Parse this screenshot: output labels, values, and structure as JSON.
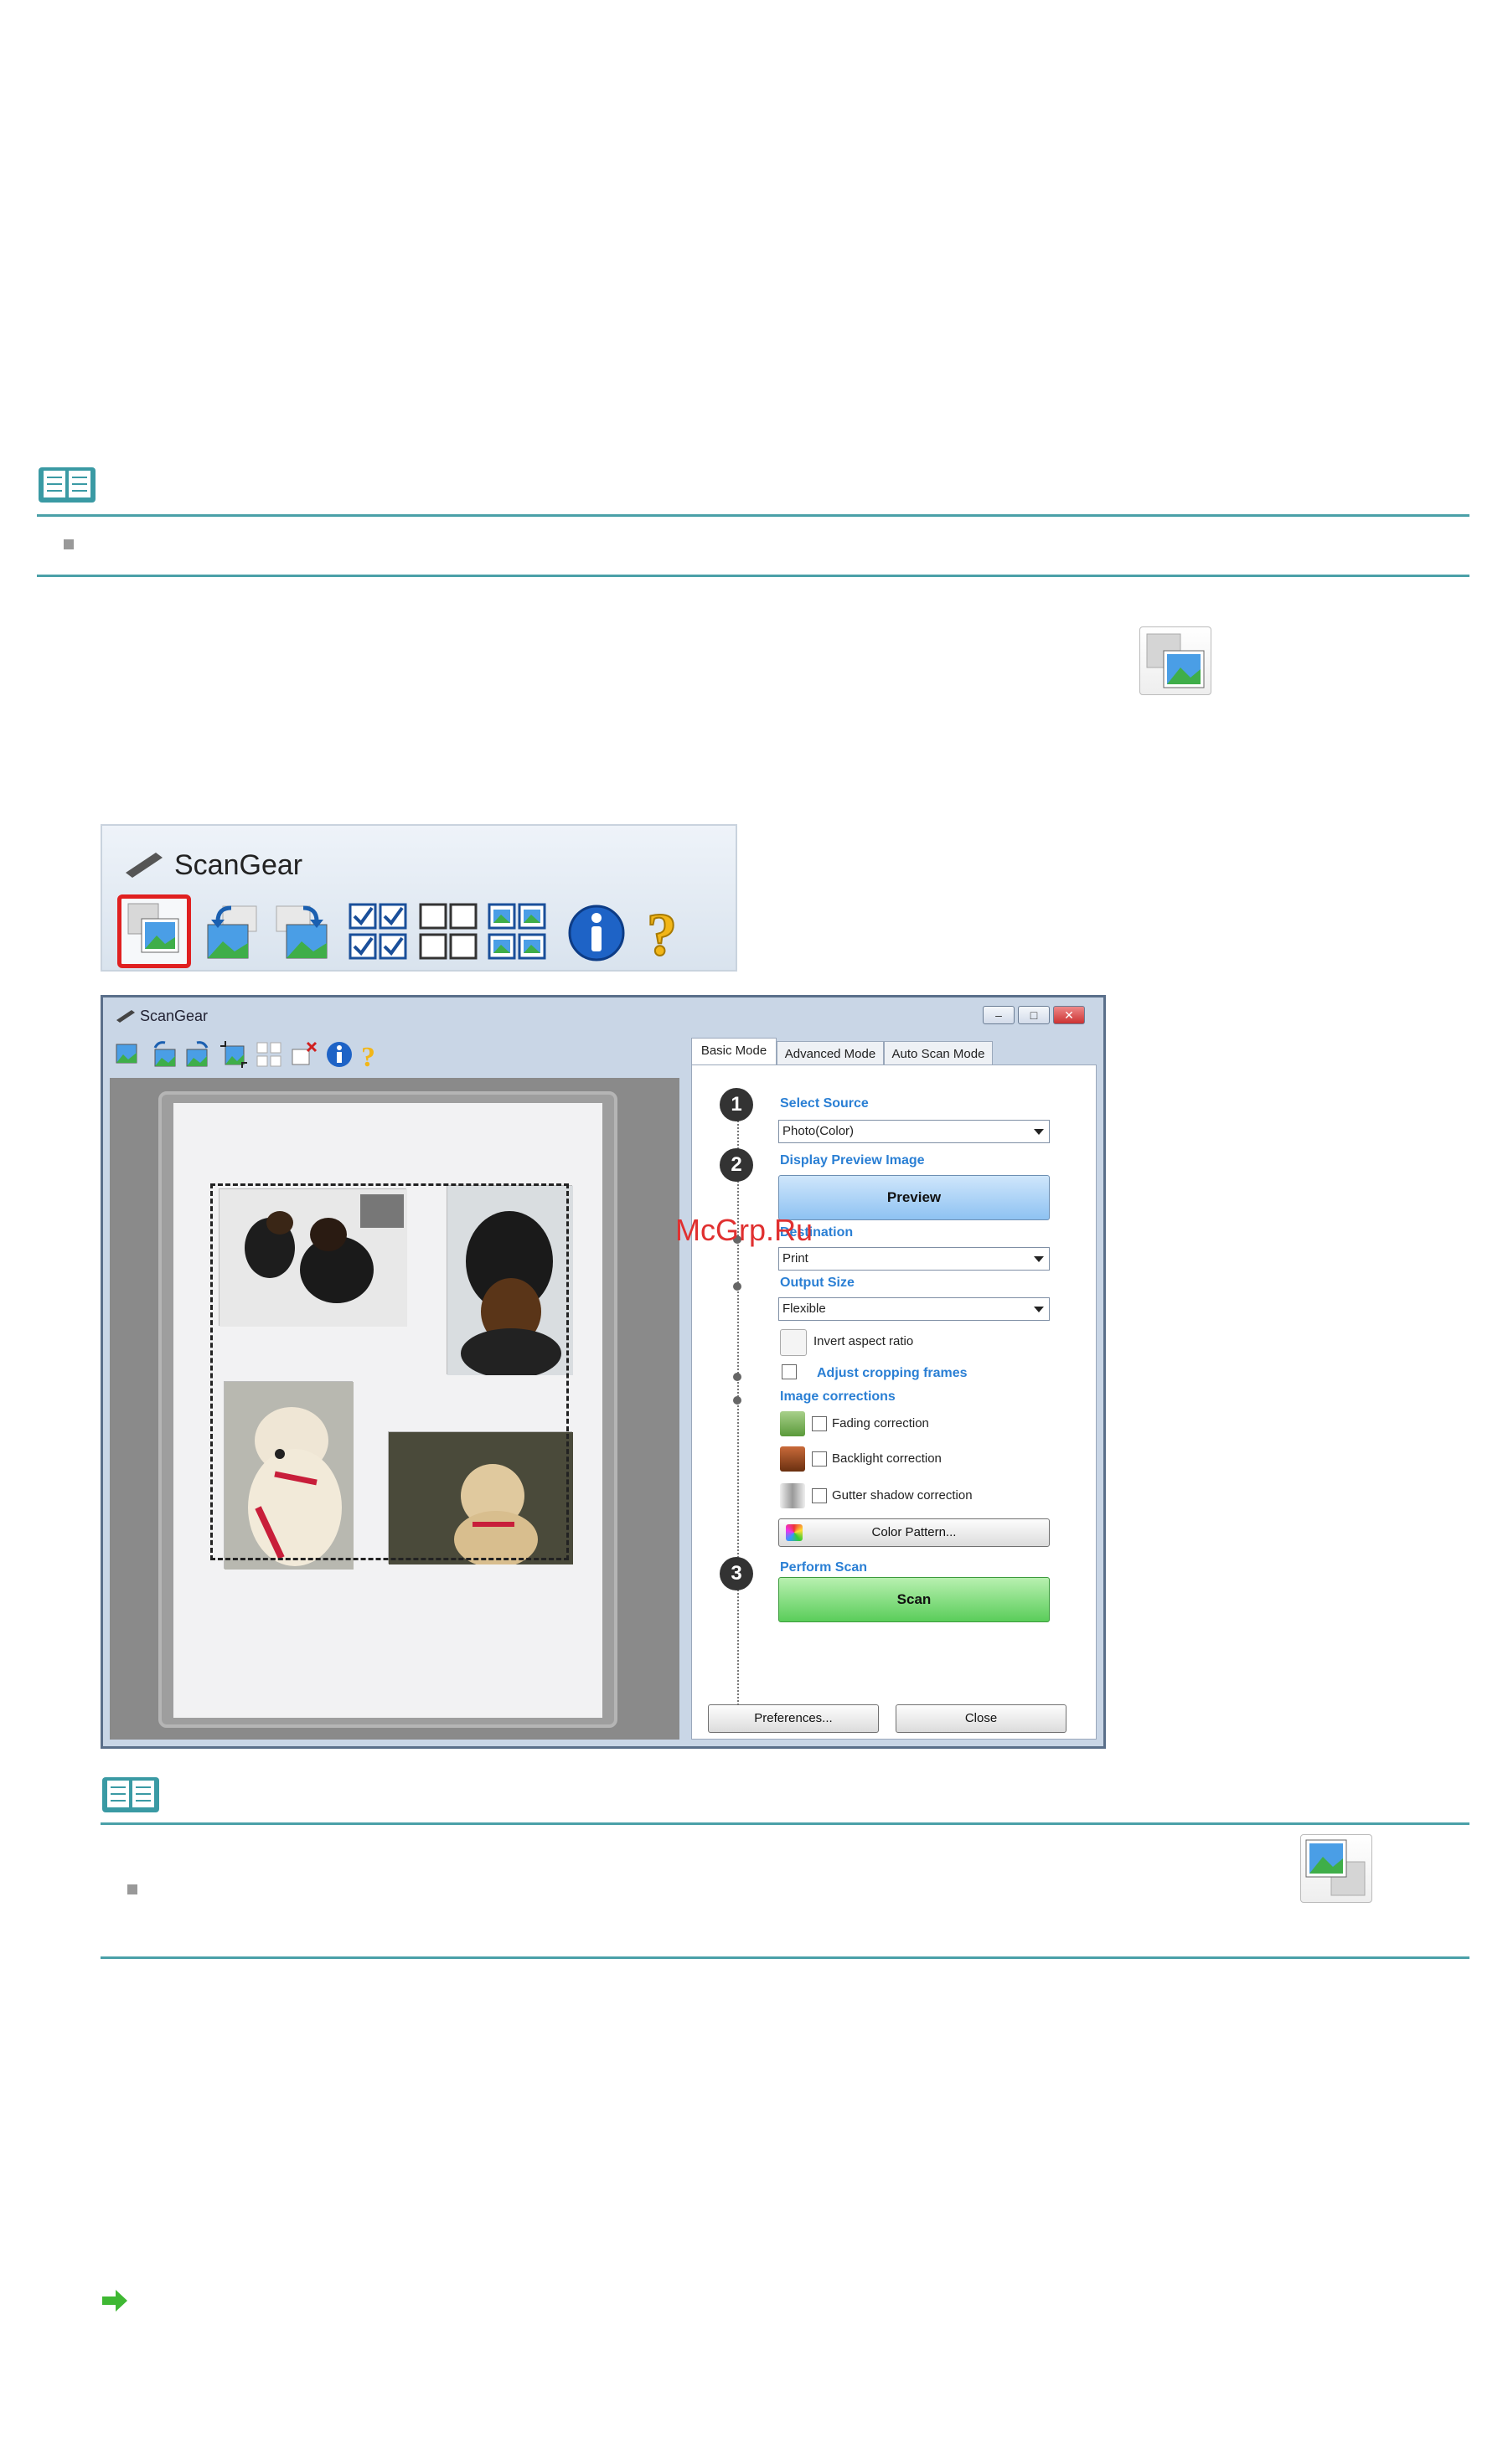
{
  "note1": {
    "icon": "book-note-icon"
  },
  "inline_icons": {
    "top_right": "scan-switch-icon",
    "note2_right": "scan-switch-icon"
  },
  "toolbar_strip": {
    "title": "ScanGear",
    "buttons": [
      "thumbnail-view-icon",
      "rotate-left-icon",
      "rotate-right-icon",
      "select-all-frames-icon",
      "deselect-all-frames-icon",
      "image-frames-icon",
      "info-icon",
      "help-icon"
    ]
  },
  "window": {
    "title": "ScanGear",
    "controls": [
      "–",
      "□",
      "✕"
    ],
    "tabs": [
      "Basic Mode",
      "Advanced Mode",
      "Auto Scan Mode"
    ],
    "step1": {
      "num": "1",
      "label": "Select Source",
      "value": "Photo(Color)"
    },
    "step2": {
      "num": "2",
      "label": "Display Preview Image",
      "button": "Preview"
    },
    "destination": {
      "label": "Destination",
      "value": "Print"
    },
    "output_size": {
      "label": "Output Size",
      "value": "Flexible",
      "invert": "Invert aspect ratio"
    },
    "adjust_cropping": "Adjust cropping frames",
    "image_corrections": {
      "label": "Image corrections",
      "fading": "Fading correction",
      "backlight": "Backlight correction",
      "gutter": "Gutter shadow correction",
      "color_pattern": "Color Pattern..."
    },
    "step3": {
      "num": "3",
      "label": "Perform Scan",
      "button": "Scan"
    },
    "preferences": "Preferences...",
    "close": "Close"
  },
  "watermark": "McGrp.Ru",
  "next_arrow": "arrow-right-icon",
  "colors": {
    "rule": "#4aa0a8",
    "highlight": "#e02020",
    "link_blue": "#2a7fd4",
    "scan_green": "#6ad66a"
  }
}
